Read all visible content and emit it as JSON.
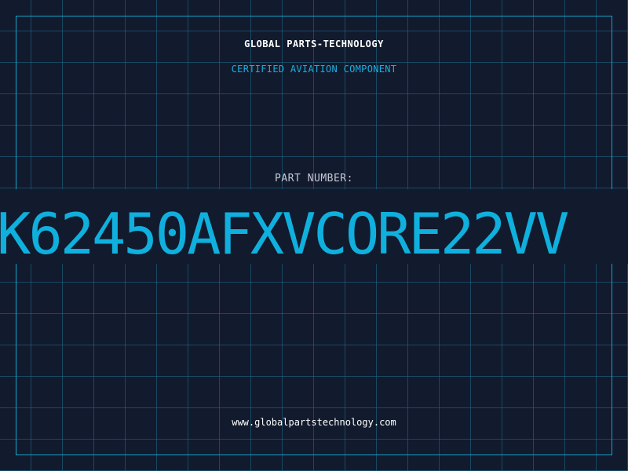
{
  "header": {
    "company": "GLOBAL PARTS-TECHNOLOGY",
    "subtitle": "CERTIFIED AVIATION COMPONENT"
  },
  "part": {
    "label": "PART NUMBER:",
    "number": "K62450AFXVCORE22VV"
  },
  "footer": {
    "url": "www.globalpartstechnology.com"
  },
  "colors": {
    "background": "#121a2e",
    "grid": "#1e6e8c",
    "accent": "#0fb0dd",
    "text": "#ffffff"
  }
}
